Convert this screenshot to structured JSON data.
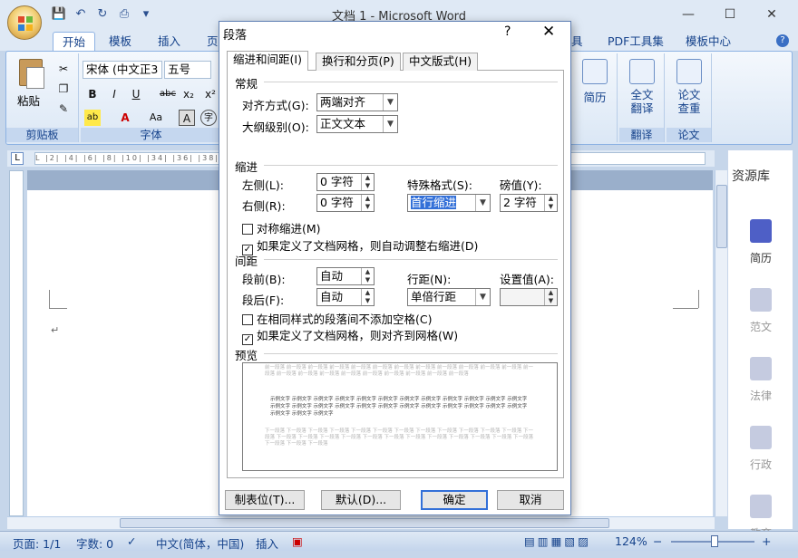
{
  "window": {
    "title": "文档 1 - Microsoft Word",
    "minimize": "—",
    "maximize": "☐",
    "close": "✕"
  },
  "ribbon_tabs": {
    "home": "开始",
    "insert_partial": "模板",
    "insert": "插入",
    "page": "页",
    "hidden": "具",
    "pdf": "PDF工具集",
    "template": "模板中心"
  },
  "ribbon": {
    "clipboard": {
      "paste": "粘贴",
      "label": "剪贴板"
    },
    "font": {
      "name": "宋体 (中文正3",
      "size": "五号",
      "label": "字体",
      "bold": "B",
      "italic": "I",
      "underline": "U",
      "strike": "abc",
      "sub": "x₂",
      "sup": "x²",
      "aa": "Aa",
      "a_box": "A",
      "wen": "字"
    },
    "resume": {
      "label": "简历"
    },
    "translate": {
      "full": "全文翻译",
      "label": "翻译"
    },
    "paper": {
      "check": "论文查重",
      "label": "论文"
    }
  },
  "ruler_text": "L  |2|  |4|  |6|  |8|  |10|                                                                        |34|  |36|  |38|  |40|  |4",
  "side_panel": {
    "title": "资源库",
    "items": [
      "简历",
      "范文",
      "法律",
      "行政",
      "教育"
    ]
  },
  "statusbar": {
    "page": "页面: 1/1",
    "words": "字数: 0",
    "lang": "中文(简体，中国)",
    "mode": "插入",
    "zoom": "124%",
    "zoom_minus": "−",
    "zoom_plus": "+"
  },
  "dialog": {
    "title": "段落",
    "help": "?",
    "close": "✕",
    "tabs": [
      "缩进和间距(I)",
      "换行和分页(P)",
      "中文版式(H)"
    ],
    "general": {
      "heading": "常规",
      "align_label": "对齐方式(G):",
      "align_value": "两端对齐",
      "outline_label": "大纲级别(O):",
      "outline_value": "正文文本"
    },
    "indent": {
      "heading": "缩进",
      "left_label": "左侧(L):",
      "left_value": "0 字符",
      "right_label": "右侧(R):",
      "right_value": "0 字符",
      "special_label": "特殊格式(S):",
      "special_value": "首行缩进",
      "by_label": "磅值(Y):",
      "by_value": "2 字符",
      "mirror": "对称缩进(M)",
      "auto_adjust": "如果定义了文档网格，则自动调整右缩进(D)"
    },
    "spacing": {
      "heading": "间距",
      "before_label": "段前(B):",
      "before_value": "自动",
      "after_label": "段后(F):",
      "after_value": "自动",
      "line_label": "行距(N):",
      "line_value": "单倍行距",
      "at_label": "设置值(A):",
      "at_value": "",
      "no_space": "在相同样式的段落间不添加空格(C)",
      "snap_grid": "如果定义了文档网格，则对齐到网格(W)"
    },
    "preview": {
      "heading": "预览",
      "prev_para": "前一段落 前一段落 前一段落 前一段落 前一段落 前一段落 前一段落 前一段落 前一段落 前一段落 前一段落 前一段落 前一段落 前一段落 前一段落 前一段落 前一段落 前一段落 前一段落 前一段落 前一段落 前一段落",
      "sample": "示例文字 示例文字 示例文字 示例文字 示例文字 示例文字 示例文字 示例文字 示例文字 示例文字 示例文字 示例文字 示例文字 示例文字 示例文字 示例文字 示例文字 示例文字 示例文字 示例文字 示例文字 示例文字 示例文字 示例文字 示例文字 示例文字 示例文字",
      "next_para": "下一段落 下一段落 下一段落 下一段落 下一段落 下一段落 下一段落 下一段落 下一段落 下一段落 下一段落 下一段落 下一段落 下一段落 下一段落 下一段落 下一段落 下一段落 下一段落 下一段落 下一段落 下一段落 下一段落 下一段落 下一段落 下一段落 下一段落 下一段落"
    },
    "buttons": {
      "tabs": "制表位(T)...",
      "default": "默认(D)...",
      "ok": "确定",
      "cancel": "取消"
    }
  }
}
